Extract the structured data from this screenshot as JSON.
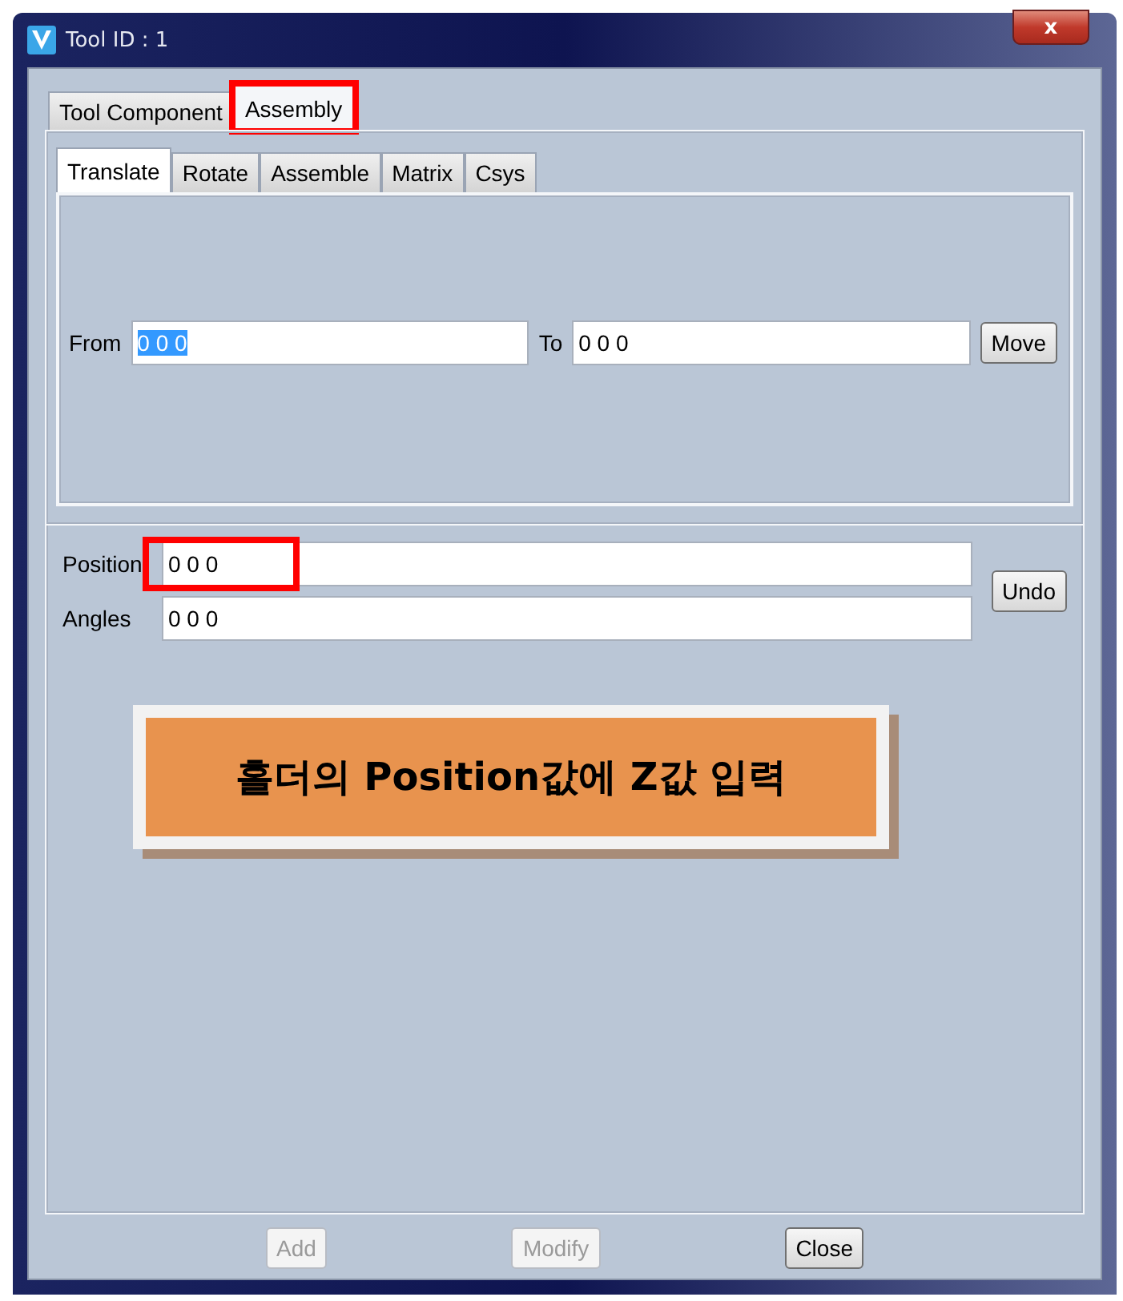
{
  "window": {
    "title": "Tool ID : 1",
    "close_label": "x"
  },
  "tabs": [
    {
      "label": "Tool Component",
      "selected": false,
      "highlighted": false
    },
    {
      "label": "Assembly",
      "selected": true,
      "highlighted": true
    }
  ],
  "subtabs": [
    {
      "label": "Translate",
      "selected": true
    },
    {
      "label": "Rotate",
      "selected": false
    },
    {
      "label": "Assemble",
      "selected": false
    },
    {
      "label": "Matrix",
      "selected": false
    },
    {
      "label": "Csys",
      "selected": false
    }
  ],
  "translate": {
    "from_label": "From",
    "from_value": "0 0 0",
    "from_text_selected": true,
    "to_label": "To",
    "to_value": "0 0 0",
    "move_button": "Move"
  },
  "transform": {
    "fields": [
      {
        "label": "Position",
        "value": "0 0 0",
        "highlighted": true
      },
      {
        "label": "Angles",
        "value": "0 0 0",
        "highlighted": false
      }
    ],
    "undo_button": "Undo"
  },
  "callout": {
    "text": "홀더의 Position값에 Z값 입력"
  },
  "buttons": [
    {
      "label": "Add",
      "disabled": true
    },
    {
      "label": "Modify",
      "disabled": true
    },
    {
      "label": "Close",
      "disabled": false
    }
  ]
}
